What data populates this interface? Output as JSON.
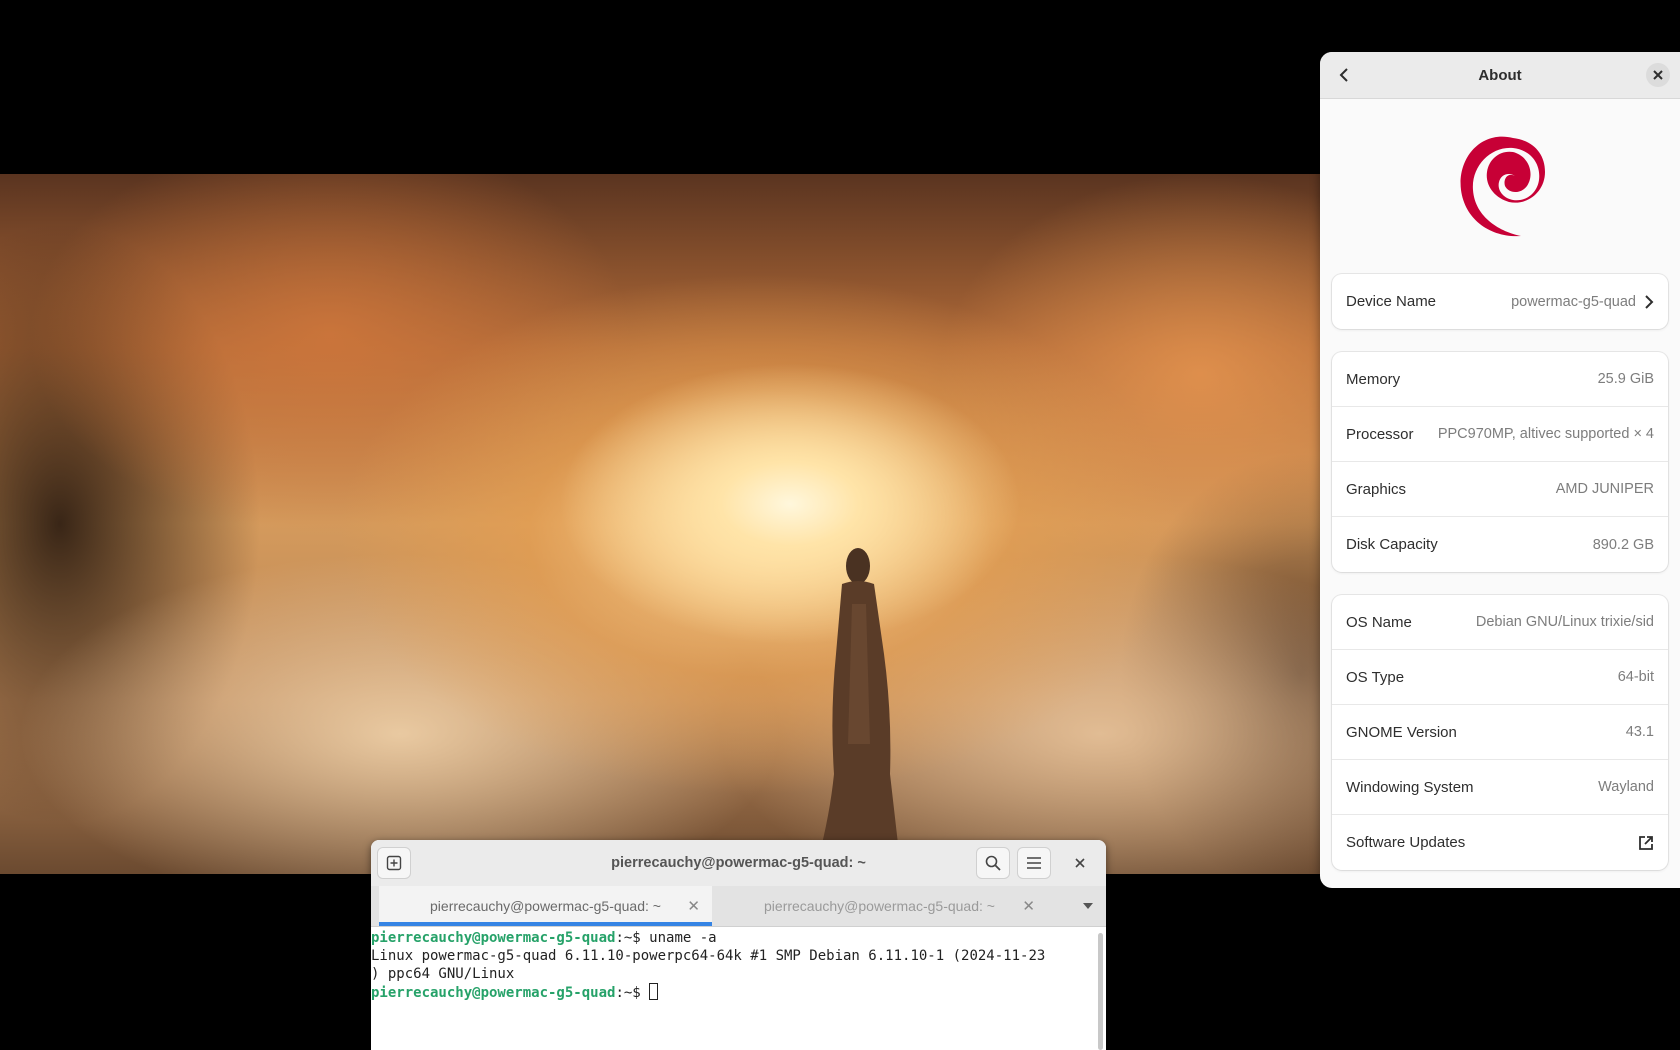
{
  "about": {
    "title": "About",
    "device": {
      "label": "Device Name",
      "value": "powermac-g5-quad"
    },
    "hardware": [
      {
        "label": "Memory",
        "value": "25.9 GiB"
      },
      {
        "label": "Processor",
        "value": "PPC970MP, altivec supported × 4"
      },
      {
        "label": "Graphics",
        "value": "AMD JUNIPER"
      },
      {
        "label": "Disk Capacity",
        "value": "890.2 GB"
      }
    ],
    "software": [
      {
        "label": "OS Name",
        "value": "Debian GNU/Linux trixie/sid"
      },
      {
        "label": "OS Type",
        "value": "64-bit"
      },
      {
        "label": "GNOME Version",
        "value": "43.1"
      },
      {
        "label": "Windowing System",
        "value": "Wayland"
      },
      {
        "label": "Software Updates",
        "value": ""
      }
    ],
    "icons": {
      "back": "chevron-left-icon",
      "close": "close-icon",
      "device_arrow": "chevron-right-icon",
      "updates": "external-link-icon",
      "logo": "debian-swirl-logo"
    },
    "logo_color": "#c70036"
  },
  "terminal": {
    "title": "pierrecauchy@powermac-g5-quad: ~",
    "tabs": [
      {
        "label": "pierrecauchy@powermac-g5-quad: ~",
        "active": true
      },
      {
        "label": "pierrecauchy@powermac-g5-quad: ~",
        "active": false
      }
    ],
    "prompt_user": "pierrecauchy@powermac-g5-quad",
    "prompt_suffix": ":~$ ",
    "command": "uname -a",
    "output_line1": "Linux powermac-g5-quad 6.11.10-powerpc64-64k #1 SMP Debian 6.11.10-1 (2024-11-23",
    "output_line2": ") ppc64 GNU/Linux",
    "accent": "#3584e4",
    "prompt_color": "#26a269"
  }
}
